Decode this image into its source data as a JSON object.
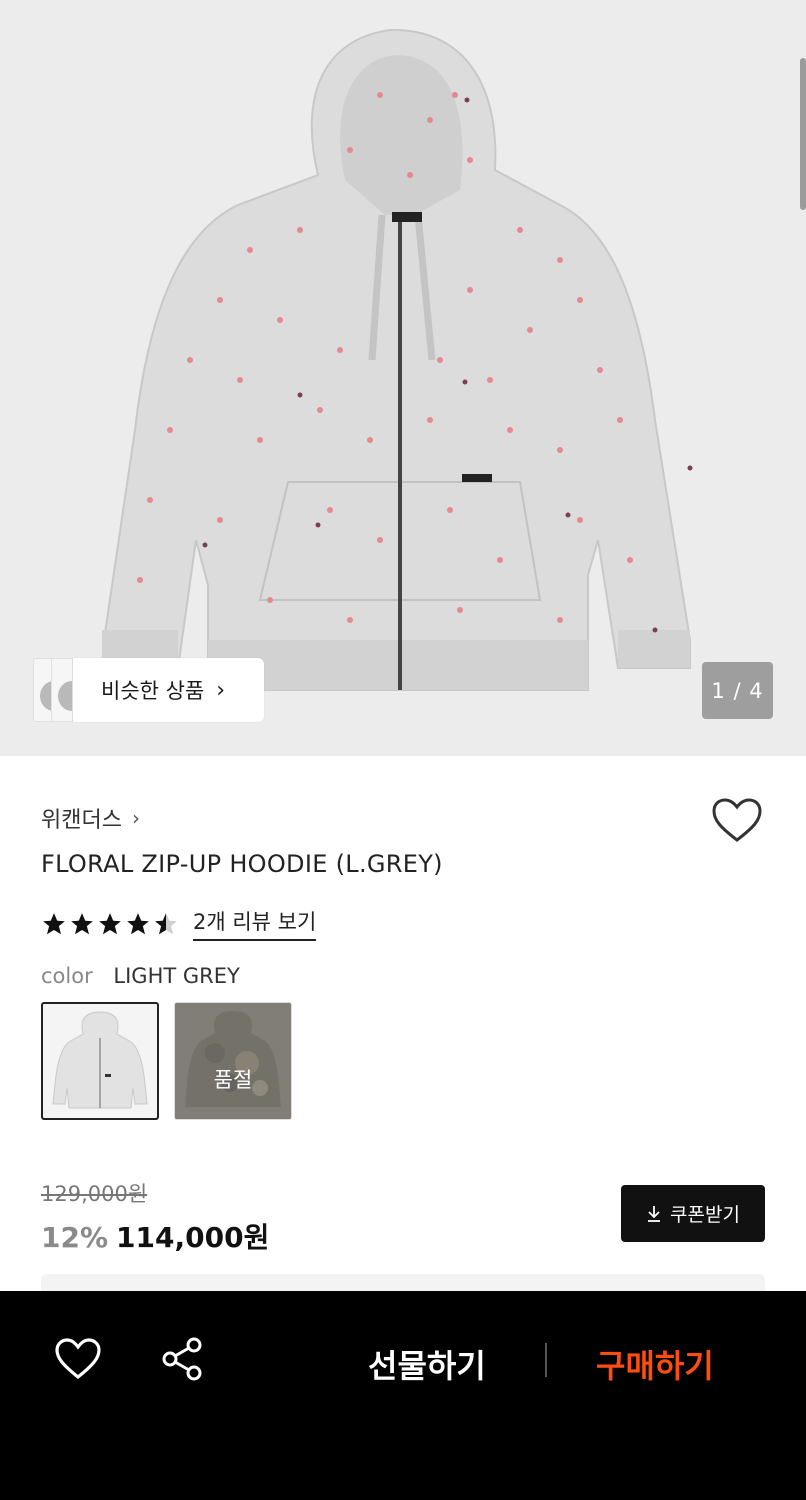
{
  "gallery": {
    "counter": "1 / 4",
    "similar_label": "비슷한 상품",
    "similar_chevron": "›"
  },
  "product": {
    "brand": "위캔더스",
    "brand_chevron": "›",
    "name": "FLORAL ZIP-UP HOODIE (L.GREY)",
    "rating": 4.5,
    "review_link": "2개 리뷰 보기",
    "color_label": "color",
    "color_value": "LIGHT GREY",
    "swatches": [
      {
        "name": "LIGHT GREY",
        "selected": true,
        "sold_out": false
      },
      {
        "name": "",
        "selected": false,
        "sold_out": true,
        "sold_out_label": "품절"
      }
    ],
    "original_price": "129,000원",
    "discount": "12%",
    "sale_price": "114,000원",
    "coupon_label": "쿠폰받기"
  },
  "bottom_bar": {
    "gift_label": "선물하기",
    "buy_label": "구매하기",
    "buy_color": "#ff4d12"
  },
  "icons": [
    "heart-icon",
    "share-icon",
    "download-icon",
    "chevron-right-icon",
    "star-icon"
  ]
}
